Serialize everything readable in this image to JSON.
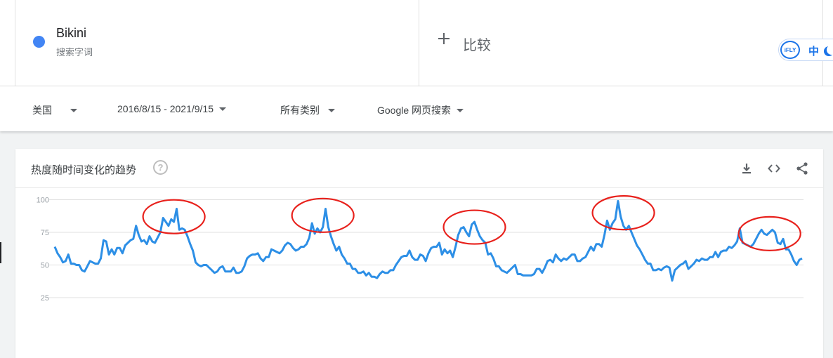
{
  "colors": {
    "series": "#2d8fe6",
    "term_dot": "#4285f4",
    "annotation": "#e8211c",
    "grid": "#e0e0e0",
    "tick": "#9aa0a6"
  },
  "search_term": {
    "name": "Bikini",
    "subtitle": "搜索字词"
  },
  "compare": {
    "label": "比较",
    "icon": "plus-icon"
  },
  "ifly": {
    "logo": "iFLY",
    "lang": "中",
    "icon": "moon-icon"
  },
  "filters": [
    {
      "label": "美国"
    },
    {
      "label": "2016/8/15 - 2021/9/15"
    },
    {
      "label": "所有类别"
    },
    {
      "label": "Google 网页搜索"
    }
  ],
  "card": {
    "title": "热度随时间变化的趋势",
    "help_icon": "question-mark-icon",
    "actions": [
      "download-icon",
      "embed-code-icon",
      "share-icon"
    ]
  },
  "chart_data": {
    "type": "line",
    "title": "",
    "xlabel": "",
    "ylabel": "",
    "y_ticks": [
      100,
      75,
      50,
      25
    ],
    "ylim": [
      0,
      100
    ],
    "grid": true,
    "legend": "none",
    "series": [
      {
        "values": [
          64,
          59,
          56,
          52,
          53,
          58,
          51,
          51,
          50,
          50,
          46,
          45,
          49,
          53,
          52,
          51,
          51,
          55,
          69,
          68,
          58,
          62,
          58,
          63,
          63,
          59,
          65,
          67,
          69,
          70,
          80,
          73,
          68,
          69,
          66,
          72,
          68,
          67,
          71,
          75,
          86,
          83,
          80,
          85,
          83,
          93,
          77,
          78,
          77,
          72,
          66,
          61,
          52,
          50,
          49,
          50,
          50,
          48,
          46,
          44,
          45,
          48,
          49,
          45,
          45,
          45,
          48,
          44,
          44,
          45,
          49,
          55,
          57,
          58,
          58,
          59,
          55,
          53,
          56,
          56,
          62,
          61,
          60,
          59,
          61,
          65,
          67,
          66,
          63,
          61,
          62,
          64,
          64,
          66,
          71,
          82,
          74,
          78,
          75,
          79,
          93,
          79,
          72,
          66,
          61,
          64,
          58,
          55,
          51,
          51,
          47,
          47,
          44,
          44,
          45,
          42,
          44,
          41,
          41,
          40,
          43,
          45,
          44,
          44,
          46,
          46,
          50,
          53,
          56,
          57,
          57,
          61,
          56,
          54,
          54,
          58,
          57,
          53,
          59,
          63,
          64,
          64,
          67,
          58,
          62,
          59,
          61,
          56,
          64,
          73,
          78,
          79,
          75,
          72,
          81,
          83,
          77,
          72,
          69,
          67,
          58,
          59,
          55,
          49,
          49,
          46,
          45,
          44,
          46,
          48,
          50,
          43,
          43,
          42,
          42,
          42,
          42,
          43,
          47,
          47,
          44,
          48,
          53,
          54,
          52,
          58,
          55,
          53,
          55,
          54,
          56,
          58,
          58,
          53,
          53,
          55,
          56,
          60,
          64,
          61,
          66,
          66,
          64,
          73,
          84,
          77,
          82,
          85,
          99,
          87,
          80,
          77,
          80,
          75,
          70,
          65,
          62,
          58,
          54,
          51,
          51,
          46,
          46,
          47,
          46,
          48,
          49,
          48,
          38,
          46,
          48,
          50,
          51,
          53,
          47,
          49,
          51,
          54,
          53,
          55,
          54,
          54,
          56,
          56,
          60,
          56,
          60,
          61,
          61,
          64,
          63,
          65,
          68,
          78,
          67,
          66,
          65,
          64,
          66,
          70,
          74,
          77,
          74,
          73,
          75,
          77,
          75,
          67,
          66,
          70,
          62,
          62,
          58,
          53,
          50,
          54,
          55
        ]
      }
    ],
    "annotations": [
      {
        "shape": "ellipse",
        "cx": 44,
        "cy": 87
      },
      {
        "shape": "ellipse",
        "cx": 99,
        "cy": 88
      },
      {
        "shape": "ellipse",
        "cx": 155,
        "cy": 79
      },
      {
        "shape": "ellipse",
        "cx": 210,
        "cy": 90
      },
      {
        "shape": "ellipse",
        "cx": 264,
        "cy": 74
      }
    ]
  }
}
